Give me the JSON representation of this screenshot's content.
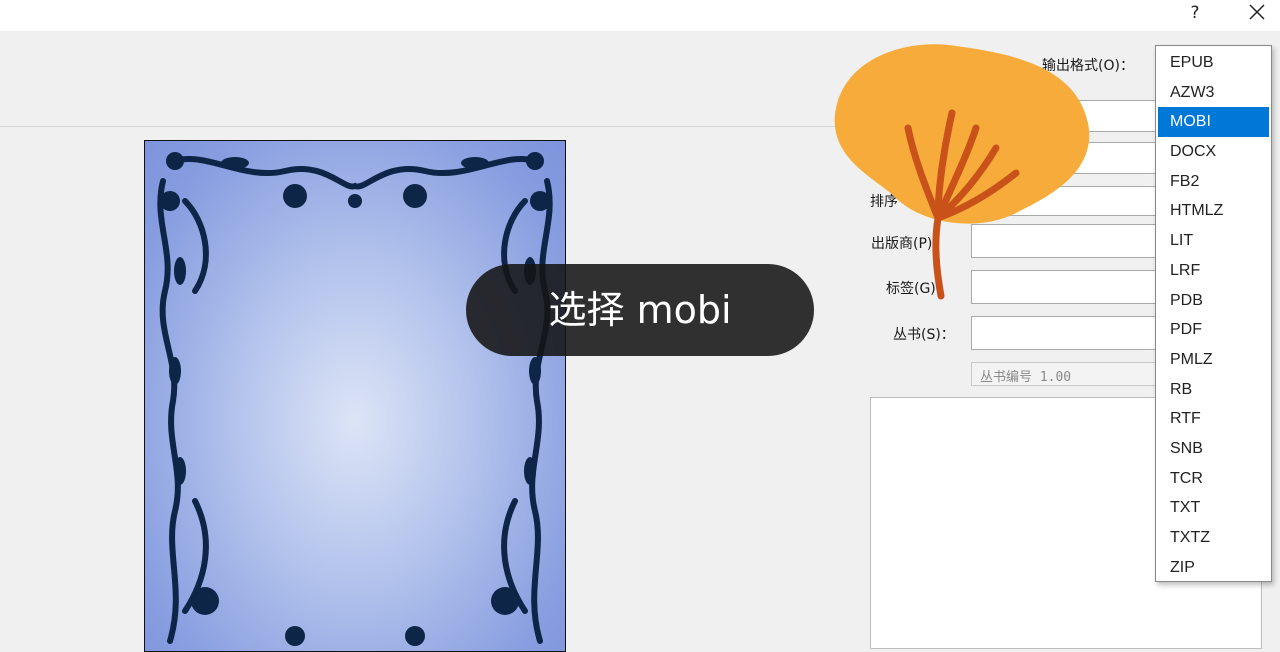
{
  "window": {
    "help_label": "?",
    "close_icon": "close-icon"
  },
  "metadata_form": {
    "output_format_label": "输出格式(O)：",
    "sort_label": "排序",
    "publisher_label": "出版商(P)：",
    "tags_label": "标签(G)：",
    "series_label": "丛书(S)：",
    "series_number_value": "丛书编号 1.00"
  },
  "format_dropdown": {
    "selected": "MOBI",
    "options": [
      "EPUB",
      "AZW3",
      "MOBI",
      "DOCX",
      "FB2",
      "HTMLZ",
      "LIT",
      "LRF",
      "PDB",
      "PDF",
      "PMLZ",
      "RB",
      "RTF",
      "SNB",
      "TCR",
      "TXT",
      "TXTZ",
      "ZIP"
    ]
  },
  "overlay": {
    "toast_text": "选择 mobi"
  },
  "colors": {
    "selection": "#0078d7",
    "sticker_orange": "#f7ab3a",
    "sticker_stem": "#c9521b",
    "cover_ornament": "#0d2547"
  }
}
